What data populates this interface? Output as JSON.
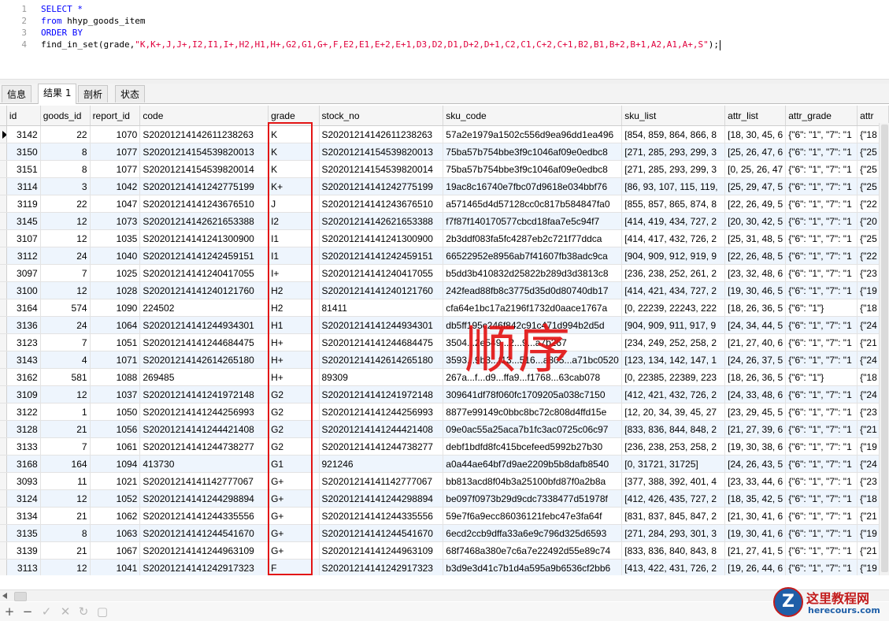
{
  "editor": {
    "line_numbers": [
      "1",
      "2",
      "3",
      "4"
    ],
    "line1": "SELECT *",
    "line2_kw": "from",
    "line2_id": " hhyp_goods_item",
    "line3": "ORDER BY",
    "line4_fn": "find_in_set(grade,",
    "line4_str": "\"K,K+,J,J+,I2,I1,I+,H2,H1,H+,G2,G1,G+,F,E2,E1,E+2,E+1,D3,D2,D1,D+2,D+1,C2,C1,C+2,C+1,B2,B1,B+2,B+1,A2,A1,A+,S\"",
    "line4_end": ");"
  },
  "tabs": [
    {
      "label": "信息"
    },
    {
      "label": "结果 1"
    },
    {
      "label": "剖析"
    },
    {
      "label": "状态"
    }
  ],
  "grid": {
    "columns": [
      "id",
      "goods_id",
      "report_id",
      "code",
      "grade",
      "stock_no",
      "sku_code",
      "sku_list",
      "attr_list",
      "attr_grade",
      "attr"
    ],
    "rows": [
      [
        "3142",
        "22",
        "1070",
        "S20201214142611238263",
        "K",
        "S20201214142611238263",
        "57a2e1979a1502c556d9ea96dd1ea496",
        "[854, 859, 864, 866, 8",
        "[18, 30, 45, 6",
        "{\"6\": \"1\", \"7\": \"1",
        "{\"18"
      ],
      [
        "3150",
        "8",
        "1077",
        "S20201214154539820013",
        "K",
        "S20201214154539820013",
        "75ba57b754bbe3f9c1046af09e0edbc8",
        "[271, 285, 293, 299, 3",
        "[25, 26, 47, 6",
        "{\"6\": \"1\", \"7\": \"1",
        "{\"25"
      ],
      [
        "3151",
        "8",
        "1077",
        "S20201214154539820014",
        "K",
        "S20201214154539820014",
        "75ba57b754bbe3f9c1046af09e0edbc8",
        "[271, 285, 293, 299, 3",
        "[0, 25, 26, 47",
        "{\"6\": \"1\", \"7\": \"1",
        "{\"25"
      ],
      [
        "3114",
        "3",
        "1042",
        "S20201214141242775199",
        "K+",
        "S20201214141242775199",
        "19ac8c16740e7fbc07d9618e034bbf76",
        "[86, 93, 107, 115, 119,",
        "[25, 29, 47, 5",
        "{\"6\": \"1\", \"7\": \"1",
        "{\"25"
      ],
      [
        "3119",
        "22",
        "1047",
        "S20201214141243676510",
        "J",
        "S20201214141243676510",
        "a571465d4d57128cc0c817b584847fa0",
        "[855, 857, 865, 874, 8",
        "[22, 26, 49, 5",
        "{\"6\": \"1\", \"7\": \"1",
        "{\"22"
      ],
      [
        "3145",
        "12",
        "1073",
        "S20201214142621653388",
        "I2",
        "S20201214142621653388",
        "f7f87f140170577cbcd18faa7e5c94f7",
        "[414, 419, 434, 727, 2",
        "[20, 30, 42, 5",
        "{\"6\": \"1\", \"7\": \"1",
        "{\"20"
      ],
      [
        "3107",
        "12",
        "1035",
        "S20201214141241300900",
        "I1",
        "S20201214141241300900",
        "2b3ddf083fa5fc4287eb2c721f77ddca",
        "[414, 417, 432, 726, 2",
        "[25, 31, 48, 5",
        "{\"6\": \"1\", \"7\": \"1",
        "{\"25"
      ],
      [
        "3112",
        "24",
        "1040",
        "S20201214141242459151",
        "I1",
        "S20201214141242459151",
        "66522952e8956ab7f41607fb38adc9ca",
        "[904, 909, 912, 919, 9",
        "[22, 26, 48, 5",
        "{\"6\": \"1\", \"7\": \"1",
        "{\"22"
      ],
      [
        "3097",
        "7",
        "1025",
        "S20201214141240417055",
        "I+",
        "S20201214141240417055",
        "b5dd3b410832d25822b289d3d3813c8",
        "[236, 238, 252, 261, 2",
        "[23, 32, 48, 6",
        "{\"6\": \"1\", \"7\": \"1",
        "{\"23"
      ],
      [
        "3100",
        "12",
        "1028",
        "S20201214141240121760",
        "H2",
        "S20201214141240121760",
        "242fead88fb8c3775d35d0d80740db17",
        "[414, 421, 434, 727, 2",
        "[19, 30, 46, 5",
        "{\"6\": \"1\", \"7\": \"1",
        "{\"19"
      ],
      [
        "3164",
        "574",
        "1090",
        "224502",
        "H2",
        "81411",
        "cfa64e1bc17a2196f1732d0aace1767a",
        "[0, 22239, 22243, 222",
        "[18, 26, 36, 5",
        "{\"6\": \"1\"}",
        "{\"18"
      ],
      [
        "3136",
        "24",
        "1064",
        "S20201214141244934301",
        "H1",
        "S20201214141244934301",
        "db5ff195c246f842c91c471d994b2d5d",
        "[904, 909, 911, 917, 9",
        "[24, 34, 44, 5",
        "{\"6\": \"1\", \"7\": \"1",
        "{\"24"
      ],
      [
        "3123",
        "7",
        "1051",
        "S20201214141244684475",
        "H+",
        "S20201214141244684475",
        "3504...2e549...2...9...a7b267",
        "[234, 249, 252, 258, 2",
        "[21, 27, 40, 6",
        "{\"6\": \"1\", \"7\": \"1",
        "{\"21"
      ],
      [
        "3143",
        "4",
        "1071",
        "S20201214142614265180",
        "H+",
        "S20201214142614265180",
        "3593...9b3...f13...516...a805...a71bc0520",
        "[123, 134, 142, 147, 1",
        "[24, 26, 37, 5",
        "{\"6\": \"1\", \"7\": \"1",
        "{\"24"
      ],
      [
        "3162",
        "581",
        "1088",
        "269485",
        "H+",
        "89309",
        "267a...f...d9...ffa9...f1768...63cab078",
        "[0, 22385, 22389, 223",
        "[18, 26, 36, 5",
        "{\"6\": \"1\"}",
        "{\"18"
      ],
      [
        "3109",
        "12",
        "1037",
        "S20201214141241972148",
        "G2",
        "S20201214141241972148",
        "309641df78f060fc1709205a038c7150",
        "[412, 421, 432, 726, 2",
        "[24, 33, 48, 6",
        "{\"6\": \"1\", \"7\": \"1",
        "{\"24"
      ],
      [
        "3122",
        "1",
        "1050",
        "S20201214141244256993",
        "G2",
        "S20201214141244256993",
        "8877e99149c0bbc8bc72c808d4ffd15e",
        "[12, 20, 34, 39, 45, 27",
        "[23, 29, 45, 5",
        "{\"6\": \"1\", \"7\": \"1",
        "{\"23"
      ],
      [
        "3128",
        "21",
        "1056",
        "S20201214141244421408",
        "G2",
        "S20201214141244421408",
        "09e0ac55a25aca7b1fc3ac0725c06c97",
        "[833, 836, 844, 848, 2",
        "[21, 27, 39, 6",
        "{\"6\": \"1\", \"7\": \"1",
        "{\"21"
      ],
      [
        "3133",
        "7",
        "1061",
        "S20201214141244738277",
        "G2",
        "S20201214141244738277",
        "debf1bdfd8fc415bcefeed5992b27b30",
        "[236, 238, 253, 258, 2",
        "[19, 30, 38, 6",
        "{\"6\": \"1\", \"7\": \"1",
        "{\"19"
      ],
      [
        "3168",
        "164",
        "1094",
        "413730",
        "G1",
        "921246",
        "a0a44ae64bf7d9ae2209b5b8dafb8540",
        "[0, 31721, 31725]",
        "[24, 26, 43, 5",
        "{\"6\": \"1\", \"7\": \"1",
        "{\"24"
      ],
      [
        "3093",
        "11",
        "1021",
        "S20201214141142777067",
        "G+",
        "S20201214141142777067",
        "bb813acd8f04b3a25100bfd87f0a2b8a",
        "[377, 388, 392, 401, 4",
        "[23, 33, 44, 6",
        "{\"6\": \"1\", \"7\": \"1",
        "{\"23"
      ],
      [
        "3124",
        "12",
        "1052",
        "S20201214141244298894",
        "G+",
        "S20201214141244298894",
        "be097f0973b29d9cdc7338477d51978f",
        "[412, 426, 435, 727, 2",
        "[18, 35, 42, 5",
        "{\"6\": \"1\", \"7\": \"1",
        "{\"18"
      ],
      [
        "3134",
        "21",
        "1062",
        "S20201214141244335556",
        "G+",
        "S20201214141244335556",
        "59e7f6a9ecc86036121febc47e3fa64f",
        "[831, 837, 845, 847, 2",
        "[21, 30, 41, 6",
        "{\"6\": \"1\", \"7\": \"1",
        "{\"21"
      ],
      [
        "3135",
        "8",
        "1063",
        "S20201214141244541670",
        "G+",
        "S20201214141244541670",
        "6ecd2ccb9dffa33a6e9c796d325d6593",
        "[271, 284, 293, 301, 3",
        "[19, 30, 41, 6",
        "{\"6\": \"1\", \"7\": \"1",
        "{\"19"
      ],
      [
        "3139",
        "21",
        "1067",
        "S20201214141244963109",
        "G+",
        "S20201214141244963109",
        "68f7468a380e7c6a7e22492d55e89c74",
        "[833, 836, 840, 843, 8",
        "[21, 27, 41, 5",
        "{\"6\": \"1\", \"7\": \"1",
        "{\"21"
      ],
      [
        "3113",
        "12",
        "1041",
        "S20201214141242917323",
        "F",
        "S20201214141242917323",
        "b3d9e3d41c7b1d4a595a9b6536cf2bb6",
        "[413, 422, 431, 726, 2",
        "[19, 26, 44, 6",
        "{\"6\": \"1\", \"7\": \"1",
        "{\"19"
      ]
    ]
  },
  "annotation": {
    "text": "顺序",
    "color": "#e31515"
  },
  "toolbar": {
    "add": "+",
    "remove": "−",
    "apply": "✓",
    "cancel": "✕",
    "refresh": "↻",
    "stop": "▢"
  },
  "watermark": {
    "logo_letter": "Z",
    "cn": "这里教程网",
    "en": "herecours.com"
  },
  "colors": {
    "keyword": "#0000ff",
    "string": "#e0003c",
    "highlight": "#e31515",
    "alt_row": "#eef5fd"
  }
}
